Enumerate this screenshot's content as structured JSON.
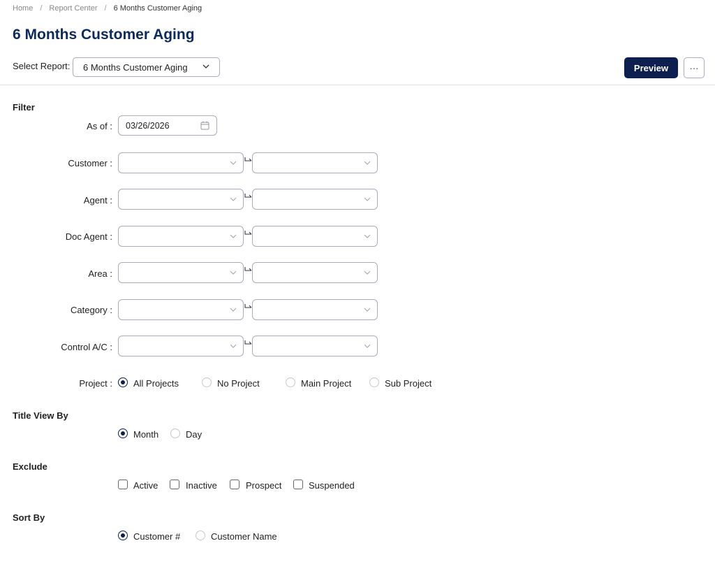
{
  "breadcrumb": {
    "home": "Home",
    "report_center": "Report Center",
    "current": "6 Months Customer Aging"
  },
  "page_title": "6 Months Customer Aging",
  "toolbar": {
    "select_report_label": "Select Report:",
    "selected_report": "6 Months Customer Aging",
    "preview_label": "Preview",
    "more_label": "···"
  },
  "filter": {
    "heading": "Filter",
    "as_of_label": "As of :",
    "as_of_value": "03/26/2026",
    "ranges": [
      {
        "label": "Customer :"
      },
      {
        "label": "Agent :"
      },
      {
        "label": "Doc Agent :"
      },
      {
        "label": "Area :"
      },
      {
        "label": "Category :"
      },
      {
        "label": "Control A/C :"
      }
    ],
    "project_label": "Project :",
    "project_options": [
      "All Projects",
      "No Project",
      "Main Project",
      "Sub Project"
    ],
    "project_selected": "All Projects"
  },
  "title_view_by": {
    "heading": "Title View By",
    "options": [
      "Month",
      "Day"
    ],
    "selected": "Month"
  },
  "exclude": {
    "heading": "Exclude",
    "options": [
      "Active",
      "Inactive",
      "Prospect",
      "Suspended"
    ]
  },
  "sort_by": {
    "heading": "Sort By",
    "options": [
      "Customer #",
      "Customer Name"
    ],
    "selected": "Customer #"
  },
  "colors": {
    "primary": "#0d1f4e",
    "title": "#0c2a5b",
    "border": "#aab"
  }
}
